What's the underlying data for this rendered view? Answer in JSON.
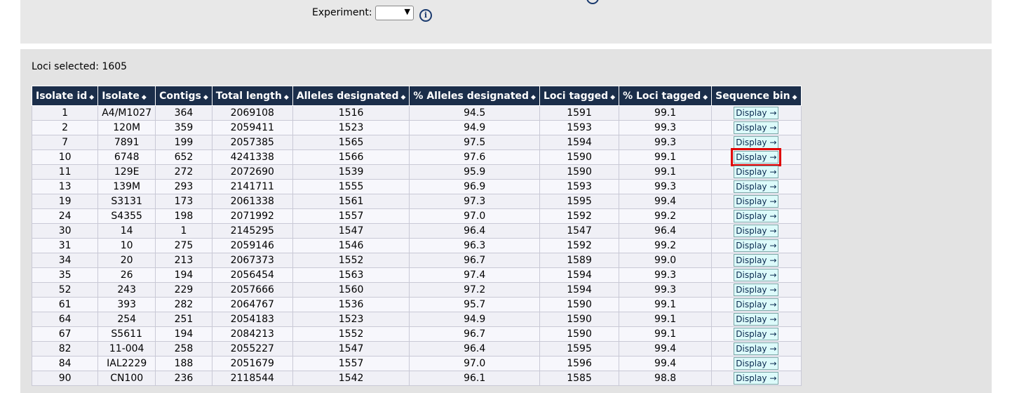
{
  "filter": {
    "experiment_label": "Experiment:",
    "experiment_value": "",
    "info_icon": "i"
  },
  "results": {
    "loci_selected": "Loci selected: 1605",
    "columns": [
      "Isolate id",
      "Isolate",
      "Contigs",
      "Total length",
      "Alleles designated",
      "% Alleles designated",
      "Loci tagged",
      "% Loci tagged",
      "Sequence bin"
    ],
    "rows": [
      [
        "1",
        "A4/M1027",
        "364",
        "2069108",
        "1516",
        "94.5",
        "1591",
        "99.1"
      ],
      [
        "2",
        "120M",
        "359",
        "2059411",
        "1523",
        "94.9",
        "1593",
        "99.3"
      ],
      [
        "7",
        "7891",
        "199",
        "2057385",
        "1565",
        "97.5",
        "1594",
        "99.3"
      ],
      [
        "10",
        "6748",
        "652",
        "4241338",
        "1566",
        "97.6",
        "1590",
        "99.1"
      ],
      [
        "11",
        "129E",
        "272",
        "2072690",
        "1539",
        "95.9",
        "1590",
        "99.1"
      ],
      [
        "13",
        "139M",
        "293",
        "2141711",
        "1555",
        "96.9",
        "1593",
        "99.3"
      ],
      [
        "19",
        "S3131",
        "173",
        "2061338",
        "1561",
        "97.3",
        "1595",
        "99.4"
      ],
      [
        "24",
        "S4355",
        "198",
        "2071992",
        "1557",
        "97.0",
        "1592",
        "99.2"
      ],
      [
        "30",
        "14",
        "1",
        "2145295",
        "1547",
        "96.4",
        "1547",
        "96.4"
      ],
      [
        "31",
        "10",
        "275",
        "2059146",
        "1546",
        "96.3",
        "1592",
        "99.2"
      ],
      [
        "34",
        "20",
        "213",
        "2067373",
        "1552",
        "96.7",
        "1589",
        "99.0"
      ],
      [
        "35",
        "26",
        "194",
        "2056454",
        "1563",
        "97.4",
        "1594",
        "99.3"
      ],
      [
        "52",
        "243",
        "229",
        "2057666",
        "1560",
        "97.2",
        "1594",
        "99.3"
      ],
      [
        "61",
        "393",
        "282",
        "2064767",
        "1536",
        "95.7",
        "1590",
        "99.1"
      ],
      [
        "64",
        "254",
        "251",
        "2054183",
        "1523",
        "94.9",
        "1590",
        "99.1"
      ],
      [
        "67",
        "S5611",
        "194",
        "2084213",
        "1552",
        "96.7",
        "1590",
        "99.1"
      ],
      [
        "82",
        "11-004",
        "258",
        "2055227",
        "1547",
        "96.4",
        "1595",
        "99.4"
      ],
      [
        "84",
        "IAL2229",
        "188",
        "2051679",
        "1557",
        "97.0",
        "1596",
        "99.4"
      ],
      [
        "90",
        "CN100",
        "236",
        "2118544",
        "1542",
        "96.1",
        "1585",
        "98.8"
      ]
    ],
    "display_label": "Display →",
    "highlighted_row": 3
  }
}
